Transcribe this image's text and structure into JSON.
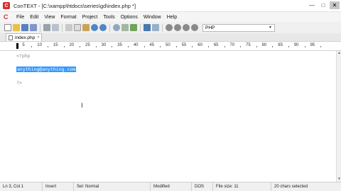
{
  "window": {
    "title": "ConTEXT - [C:\\xampp\\htdocs\\series\\gd\\index.php *]",
    "minimize_glyph": "—",
    "maximize_glyph": "□",
    "close_glyph": "✕",
    "app_icon_letter": "C"
  },
  "menu": {
    "logo_letter": "C",
    "items": [
      "File",
      "Edit",
      "View",
      "Format",
      "Project",
      "Tools",
      "Options",
      "Window",
      "Help"
    ]
  },
  "toolbar": {
    "highlighter_value": "PHP",
    "highlighter_arrow": "▼",
    "icons": [
      "new-file",
      "open-file",
      "save-file",
      "save-all",
      "print",
      "print-preview",
      "cut",
      "copy",
      "paste",
      "undo",
      "redo",
      "find",
      "find-next",
      "replace",
      "toggle-a",
      "toggle-b",
      "macro-record",
      "macro-play",
      "macro-stop",
      "macro-edit"
    ]
  },
  "tab": {
    "label": "index.php",
    "close": "×"
  },
  "ruler": {
    "labels": [
      "5",
      "10",
      "15",
      "20",
      "25",
      "30",
      "35",
      "40",
      "45",
      "50",
      "55",
      "60",
      "65",
      "70",
      "75",
      "80",
      "85",
      "90",
      "95"
    ]
  },
  "editor": {
    "line1": "<?php",
    "line3": "anything@anything.com",
    "line5": "?>",
    "cursor_glyph": "I"
  },
  "status": {
    "position": "Ln 3, Col 1",
    "mode": "Insert",
    "selection": "Sel: Normal",
    "modified": "Modified",
    "line_endings": "DOS",
    "file_size": "File size: 11",
    "chars_selected": "20 chars selected"
  },
  "colors": {
    "accent": "#d32f2f",
    "selection": "#3399ff"
  }
}
